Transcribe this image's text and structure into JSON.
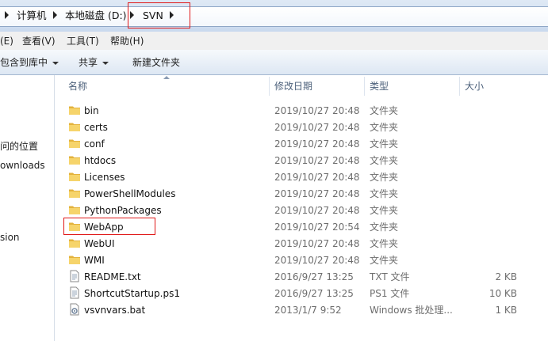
{
  "address": {
    "breadcrumbs": [
      "计算机",
      "本地磁盘 (D:)",
      "SVN"
    ]
  },
  "menu": [
    "(E)",
    "查看(V)",
    "工具(T)",
    "帮助(H)"
  ],
  "toolbar": {
    "include_library": "包含到库中",
    "share": "共享",
    "new_folder": "新建文件夹"
  },
  "nav": {
    "items": [
      "问的位置",
      "ownloads",
      "sion"
    ]
  },
  "columns": {
    "name": "名称",
    "modified": "修改日期",
    "type": "类型",
    "size": "大小"
  },
  "files": [
    {
      "icon": "folder-icon",
      "name": "bin",
      "modified": "2019/10/27 20:48",
      "type": "文件夹",
      "size": ""
    },
    {
      "icon": "folder-icon",
      "name": "certs",
      "modified": "2019/10/27 20:48",
      "type": "文件夹",
      "size": ""
    },
    {
      "icon": "folder-icon",
      "name": "conf",
      "modified": "2019/10/27 20:48",
      "type": "文件夹",
      "size": ""
    },
    {
      "icon": "folder-icon",
      "name": "htdocs",
      "modified": "2019/10/27 20:48",
      "type": "文件夹",
      "size": ""
    },
    {
      "icon": "folder-icon",
      "name": "Licenses",
      "modified": "2019/10/27 20:48",
      "type": "文件夹",
      "size": ""
    },
    {
      "icon": "folder-icon",
      "name": "PowerShellModules",
      "modified": "2019/10/27 20:48",
      "type": "文件夹",
      "size": ""
    },
    {
      "icon": "folder-icon",
      "name": "PythonPackages",
      "modified": "2019/10/27 20:48",
      "type": "文件夹",
      "size": ""
    },
    {
      "icon": "folder-icon",
      "name": "WebApp",
      "modified": "2019/10/27 20:54",
      "type": "文件夹",
      "size": ""
    },
    {
      "icon": "folder-icon",
      "name": "WebUI",
      "modified": "2019/10/27 20:48",
      "type": "文件夹",
      "size": ""
    },
    {
      "icon": "folder-icon",
      "name": "WMI",
      "modified": "2019/10/27 20:48",
      "type": "文件夹",
      "size": ""
    },
    {
      "icon": "text-file-icon",
      "name": "README.txt",
      "modified": "2016/9/27 13:25",
      "type": "TXT 文件",
      "size": "2 KB"
    },
    {
      "icon": "text-file-icon",
      "name": "ShortcutStartup.ps1",
      "modified": "2016/9/27 13:25",
      "type": "PS1 文件",
      "size": "10 KB"
    },
    {
      "icon": "batch-file-icon",
      "name": "vsvnvars.bat",
      "modified": "2013/1/7 9:52",
      "type": "Windows 批处理...",
      "size": "1 KB"
    }
  ],
  "colors": {
    "highlight_box": "#e01818",
    "folder": "#f2c94c"
  }
}
